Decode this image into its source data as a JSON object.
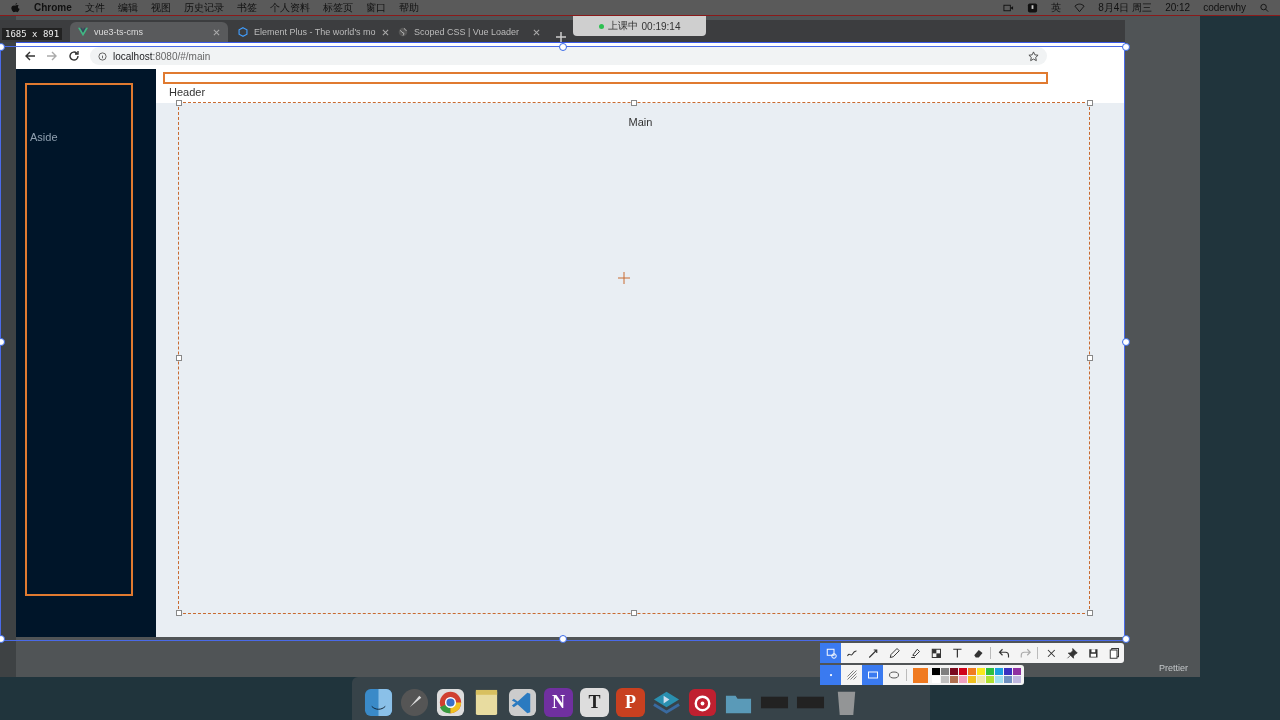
{
  "menubar": {
    "app": "Chrome",
    "menus": [
      "文件",
      "编辑",
      "视图",
      "历史记录",
      "书签",
      "个人资料",
      "标签页",
      "窗口",
      "帮助"
    ],
    "input_method": "英",
    "date": "8月4日 周三",
    "time": "20:12",
    "user": "coderwhy"
  },
  "class_timer": {
    "status": "上课中",
    "time": "00:19:14"
  },
  "capture": {
    "size": "1685 x 891"
  },
  "browser": {
    "tabs": [
      {
        "kind": "vue",
        "title": "vue3-ts-cms",
        "selected": true
      },
      {
        "kind": "element",
        "title": "Element Plus - The world's mo",
        "selected": false
      },
      {
        "kind": "globe",
        "title": "Scoped CSS | Vue Loader",
        "selected": false
      }
    ],
    "address_host": "localhost",
    "address_rest": ":8080/#/main"
  },
  "page": {
    "aside": "Aside",
    "header": "Header",
    "main": "Main"
  },
  "editor": {
    "status_item": "Prettier"
  },
  "toolbar": {
    "tools": [
      {
        "kind": "select",
        "selected": true
      },
      {
        "kind": "curve",
        "selected": false
      },
      {
        "kind": "arrow",
        "selected": false
      },
      {
        "kind": "pencil",
        "selected": false
      },
      {
        "kind": "marker",
        "selected": false
      },
      {
        "kind": "mosaic",
        "selected": false
      },
      {
        "kind": "text",
        "selected": false
      },
      {
        "kind": "eraser",
        "selected": false
      },
      {
        "kind": "undo",
        "selected": false
      },
      {
        "kind": "redo",
        "selected": false
      },
      {
        "kind": "close",
        "selected": false
      },
      {
        "kind": "pin",
        "selected": false
      },
      {
        "kind": "save",
        "selected": false
      },
      {
        "kind": "copy",
        "selected": false
      }
    ],
    "options": [
      {
        "kind": "dot",
        "selected": true
      },
      {
        "kind": "hatch",
        "selected": false
      },
      {
        "kind": "rect",
        "selected": true
      },
      {
        "kind": "ellipse",
        "selected": false
      }
    ],
    "palette": [
      {
        "color": "#000000",
        "selected": false
      },
      {
        "color": "#7f7f7f",
        "selected": false
      },
      {
        "color": "#7a0a1e",
        "selected": false
      },
      {
        "color": "#d0021b",
        "selected": false
      },
      {
        "color": "#f07a20",
        "selected": true
      },
      {
        "color": "#f8e71c",
        "selected": false
      },
      {
        "color": "#2cc040",
        "selected": false
      },
      {
        "color": "#1aa0e0",
        "selected": false
      },
      {
        "color": "#3a30c0",
        "selected": false
      },
      {
        "color": "#9030a0",
        "selected": false
      },
      {
        "color": "#ffffff",
        "selected": false
      },
      {
        "color": "#c0c0c0",
        "selected": false
      },
      {
        "color": "#b07050",
        "selected": false
      },
      {
        "color": "#f0a0c0",
        "selected": false
      },
      {
        "color": "#f0c020",
        "selected": false
      },
      {
        "color": "#f0e8a8",
        "selected": false
      },
      {
        "color": "#b0e030",
        "selected": false
      },
      {
        "color": "#a0e0f0",
        "selected": false
      },
      {
        "color": "#7090c0",
        "selected": false
      },
      {
        "color": "#c0b8e0",
        "selected": false
      }
    ]
  },
  "dock": [
    {
      "kind": "finder"
    },
    {
      "kind": "rocket"
    },
    {
      "kind": "chrome"
    },
    {
      "kind": "notes"
    },
    {
      "kind": "vscode"
    },
    {
      "kind": "onenote",
      "letter": "N"
    },
    {
      "kind": "typora",
      "letter": "T"
    },
    {
      "kind": "powerpoint",
      "letter": "P"
    },
    {
      "kind": "classroom"
    },
    {
      "kind": "music"
    },
    {
      "kind": "folder"
    },
    {
      "kind": "window"
    },
    {
      "kind": "window"
    },
    {
      "kind": "trash"
    }
  ]
}
